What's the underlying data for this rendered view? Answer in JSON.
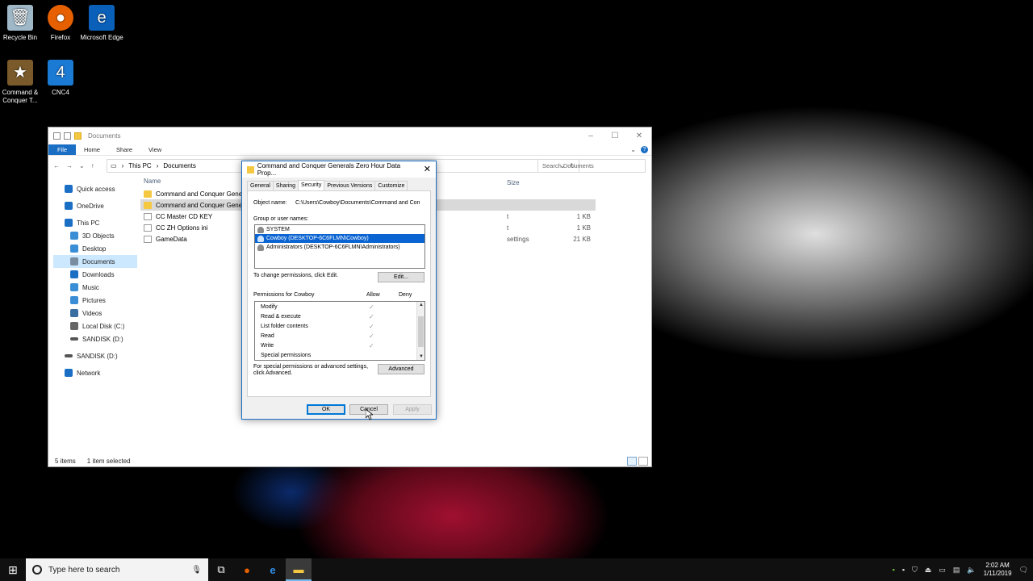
{
  "desktop": {
    "icons": [
      {
        "label": "Recycle Bin",
        "icon": "recycle-bin-icon",
        "color": "#9fb8c8"
      },
      {
        "label": "Firefox",
        "icon": "firefox-icon",
        "color": "#e66000"
      },
      {
        "label": "Microsoft Edge",
        "icon": "edge-icon",
        "color": "#0a5fb8"
      },
      {
        "label": "Command & Conquer T...",
        "icon": "command-conquer-icon",
        "color": "#7a5a2a"
      },
      {
        "label": "CNC4",
        "icon": "cnc4-icon",
        "color": "#1a7ad4"
      }
    ]
  },
  "explorer": {
    "title": "Documents",
    "ribbon": {
      "file": "File",
      "home": "Home",
      "share": "Share",
      "view": "View"
    },
    "address": {
      "this_pc": "This PC",
      "folder": "Documents"
    },
    "search_placeholder": "Search Documents",
    "nav": [
      {
        "label": "Quick access",
        "icon": "star-icon",
        "color": "#1a6fc5"
      },
      {
        "label": "OneDrive",
        "icon": "onedrive-icon",
        "color": "#1a6fc5"
      },
      {
        "label": "This PC",
        "icon": "pc-icon",
        "color": "#1a6fc5"
      },
      {
        "label": "3D Objects",
        "icon": "cube-icon",
        "color": "#3a8ed6"
      },
      {
        "label": "Desktop",
        "icon": "desktop-icon",
        "color": "#3a8ed6"
      },
      {
        "label": "Documents",
        "icon": "documents-icon",
        "color": "#7a8ca0"
      },
      {
        "label": "Downloads",
        "icon": "downloads-icon",
        "color": "#1a6fc5"
      },
      {
        "label": "Music",
        "icon": "music-icon",
        "color": "#3a8ed6"
      },
      {
        "label": "Pictures",
        "icon": "pictures-icon",
        "color": "#3a8ed6"
      },
      {
        "label": "Videos",
        "icon": "videos-icon",
        "color": "#3a6ea0"
      },
      {
        "label": "Local Disk (C:)",
        "icon": "disk-icon",
        "color": "#666666"
      },
      {
        "label": "SANDISK (D:)",
        "icon": "usb-drive-icon",
        "color": "#555555"
      },
      {
        "label": "SANDISK (D:)",
        "icon": "usb-drive-icon",
        "color": "#555555"
      },
      {
        "label": "Network",
        "icon": "network-icon",
        "color": "#1a6fc5"
      }
    ],
    "columns": {
      "name": "Name",
      "size": "Size"
    },
    "files": [
      {
        "name": "Command and Conquer Generals Zero Hour Data",
        "type": "folder"
      },
      {
        "name": "Command and Conquer Generals Zero Hour Data",
        "type": "folder"
      },
      {
        "name": "CC Master CD KEY",
        "type": "doc"
      },
      {
        "name": "CC ZH Options ini",
        "type": "doc"
      },
      {
        "name": "GameData",
        "type": "doc"
      }
    ],
    "size_rows": [
      {
        "type_text": "",
        "size": ""
      },
      {
        "type_text": "",
        "size": ""
      },
      {
        "type_text": "t",
        "size": "1 KB"
      },
      {
        "type_text": "t",
        "size": "1 KB"
      },
      {
        "type_text": "settings",
        "size": "21 KB"
      }
    ],
    "status": {
      "items": "5 items",
      "selected": "1 item selected"
    }
  },
  "dialog": {
    "title": "Command and Conquer Generals Zero Hour Data Prop...",
    "tabs": [
      "General",
      "Sharing",
      "Security",
      "Previous Versions",
      "Customize"
    ],
    "active_tab": "Security",
    "object_name_label": "Object name:",
    "object_name_value": "C:\\Users\\Cowboy\\Documents\\Command and Con",
    "group_label": "Group or user names:",
    "users": [
      "SYSTEM",
      "Cowboy (DESKTOP-6C6FLMN\\Cowboy)",
      "Administrators (DESKTOP-6C6FLMN\\Administrators)"
    ],
    "change_perm_text": "To change permissions, click Edit.",
    "edit_button": "Edit...",
    "perm_for": "Permissions for Cowboy",
    "allow": "Allow",
    "deny": "Deny",
    "permissions": [
      "Modify",
      "Read & execute",
      "List folder contents",
      "Read",
      "Write",
      "Special permissions"
    ],
    "special_text_1": "For special permissions or advanced settings,",
    "special_text_2": "click Advanced.",
    "advanced_button": "Advanced",
    "ok": "OK",
    "cancel": "Cancel",
    "apply": "Apply"
  },
  "taskbar": {
    "search_placeholder": "Type here to search",
    "time": "2:02 AM",
    "date": "1/11/2019"
  }
}
